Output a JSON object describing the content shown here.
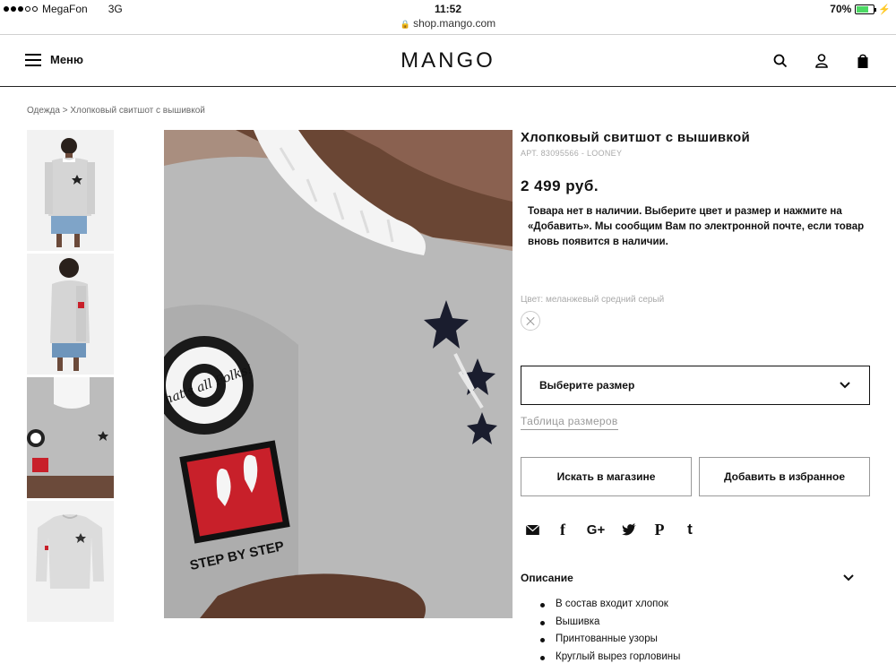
{
  "status_bar": {
    "carrier": "MegaFon",
    "network": "3G",
    "time": "11:52",
    "battery": "70%",
    "battery_level": 0.7
  },
  "browser": {
    "url": "shop.mango.com"
  },
  "header": {
    "menu_label": "Меню",
    "logo": "MANGO",
    "icons": [
      "search-icon",
      "user-icon",
      "bag-icon"
    ]
  },
  "breadcrumb": "Одежда > Хлопковый свитшот с вышивкой",
  "thumbnails": [
    "front-view",
    "back-view",
    "sleeve-detail",
    "flat-view"
  ],
  "main_image": {
    "patch_text_1": "That's all Folks!",
    "patch_text_2": "STEP BY STEP"
  },
  "product": {
    "title": "Хлопковый свитшот с вышивкой",
    "article": "АРТ. 83095566 - LOONEY",
    "price": "2 499 руб.",
    "stock_message": "Товара нет в наличии. Выберите цвет и размер и нажмите на «Добавить». Мы сообщим Вам по электронной почте, если товар вновь появится в наличии.",
    "color_label": "Цвет: меланжевый средний серый",
    "size_select": "Выберите размер",
    "size_table": "Таблица размеров",
    "btn_store": "Искать в магазине",
    "btn_favorite": "Добавить в избранное",
    "share_icons": [
      "mail-icon",
      "facebook-icon",
      "google-plus-icon",
      "twitter-icon",
      "pinterest-icon",
      "tumblr-icon"
    ],
    "description_title": "Описание",
    "description_items": [
      "В состав входит хлопок",
      "Вышивка",
      "Принтованные узоры",
      "Круглый вырез горловины"
    ]
  },
  "colors": {
    "accent": "#111111",
    "muted": "#999999",
    "patch_red": "#c8202a",
    "sweater_grey": "#b8b8b8"
  }
}
